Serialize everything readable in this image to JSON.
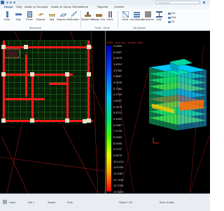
{
  "titlebar": {
    "search_placeholder": "Komut Ara"
  },
  "tabs": [
    {
      "label": "Dosya",
      "active": true
    },
    {
      "label": "Giriş"
    },
    {
      "label": "Analiz ve Sonuçlar"
    },
    {
      "label": "Analiz ve Sonuç Görüntüleme"
    },
    {
      "label": "Raporlar"
    },
    {
      "label": "Çizimler"
    }
  ],
  "ribbon": {
    "buttons": [
      {
        "label": "Kolon",
        "icon": "column-icon"
      },
      {
        "label": "Kiriş",
        "icon": "beam-icon"
      },
      {
        "label": "Perde",
        "icon": "shear-wall-icon"
      },
      {
        "label": "Döşeme",
        "icon": "slab-icon"
      },
      {
        "label": "Dişli",
        "icon": "ribbed-slab-icon"
      },
      {
        "label": "Döşeme Kenarı",
        "icon": "slab-edge-icon"
      },
      {
        "label": "Merdiven",
        "icon": "stair-icon"
      },
      {
        "label": "Sürekli Temel",
        "icon": "strip-footing-icon"
      },
      {
        "label": "Radye Temel",
        "icon": "mat-foundation-icon"
      },
      {
        "label": "Kazık",
        "icon": "pile-icon"
      },
      {
        "label": "İskele",
        "icon": "scaffold-icon"
      },
      {
        "label": "Kat Makrosu",
        "icon": "floor-macro-icon"
      },
      {
        "label": "Betonarme",
        "icon": "concrete-icon"
      },
      {
        "label": "Çelik",
        "icon": "steel-icon"
      }
    ],
    "groups": [
      "Betonarme",
      "Temel - Zemin",
      "Kat Ayarları"
    ],
    "small_items": [
      "Ara",
      "Ekle",
      "Sil"
    ]
  },
  "view3d": {
    "header": "Shell - Açık Kat - Donatı Yükü",
    "legend_values": [
      "0.0000",
      "0.5337",
      "1.0675",
      "1.6012",
      "2.1350",
      "2.6687",
      "3.2025",
      "3.7362",
      "4.2700",
      "4.8037",
      "5.3375",
      "5.8712",
      "6.4050",
      "6.9387",
      "7.4725",
      "8.0062",
      "8.5400",
      "9.0737",
      "9.6075",
      "10.1412",
      "10.6750",
      "11.2087",
      "11.7425",
      "12.2762",
      "12.8100"
    ]
  },
  "statusbar": {
    "items": [
      "Hazır",
      "Kat 1",
      "Akslar",
      "Kiriş",
      "Ölçek 1:50",
      "Mod: Analiz"
    ]
  },
  "colors": {
    "beam": "#ff1a1a",
    "slab_grid": "#1e7d1e",
    "column": "#e8e0c8",
    "axis_line": "#9a1a1a",
    "accent": "#2a6fb8"
  }
}
